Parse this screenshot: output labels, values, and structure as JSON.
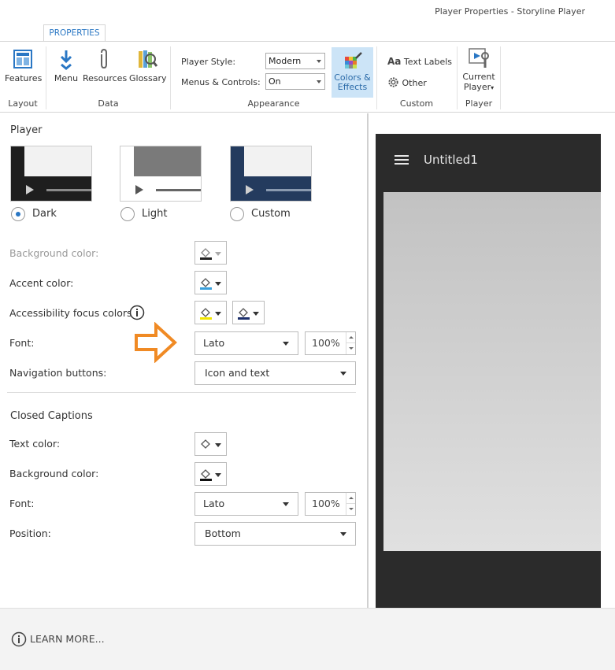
{
  "window": {
    "title": "Player Properties - Storyline Player"
  },
  "ribbon": {
    "tab": "PROPERTIES",
    "groups": {
      "layout": "Layout",
      "data": "Data",
      "appearance": "Appearance",
      "custom": "Custom",
      "player": "Player"
    },
    "features_label": "Features",
    "menu_label": "Menu",
    "resources_label": "Resources",
    "glossary_label": "Glossary",
    "player_style_label": "Player Style:",
    "player_style_value": "Modern",
    "menus_controls_label": "Menus & Controls:",
    "menus_controls_value": "On",
    "colors_effects_line1": "Colors &",
    "colors_effects_line2": "Effects",
    "text_labels_prefix": "Aa",
    "text_labels_label": "Text Labels",
    "other_label": "Other",
    "current_player_line1": "Current",
    "current_player_line2": "Player"
  },
  "player": {
    "section_title": "Player",
    "themes": [
      {
        "label": "Dark",
        "selected": true
      },
      {
        "label": "Light",
        "selected": false
      },
      {
        "label": "Custom",
        "selected": false
      }
    ],
    "background_color_label": "Background color:",
    "accent_color_label": "Accent color:",
    "accessibility_focus_label": "Accessibility focus colors:",
    "font_label": "Font:",
    "font_value": "Lato",
    "font_size": "100%",
    "navigation_label": "Navigation buttons:",
    "navigation_value": "Icon and text"
  },
  "captions": {
    "section_title": "Closed Captions",
    "text_color_label": "Text color:",
    "background_color_label": "Background color:",
    "font_label": "Font:",
    "font_value": "Lato",
    "font_size": "100%",
    "position_label": "Position:",
    "position_value": "Bottom"
  },
  "preview": {
    "title": "Untitled1"
  },
  "footer": {
    "learn_more": "LEARN MORE..."
  },
  "colors": {
    "accent": "#2a77c4",
    "dark_theme": "#1e1e1e",
    "custom_theme": "#243b5e",
    "accent_swatch": "#3aa0dc",
    "focus_yellow": "#f2e600",
    "focus_navy": "#1c2f6b",
    "callout_arrow": "#f08a24"
  }
}
